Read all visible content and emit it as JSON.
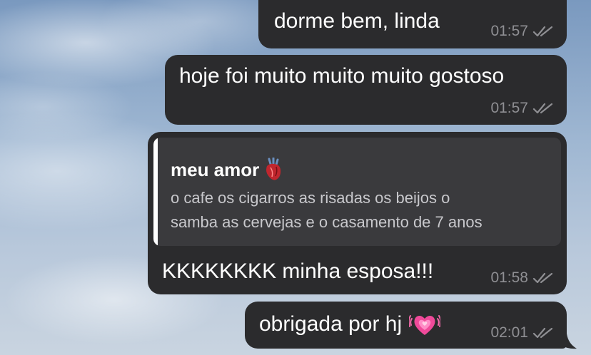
{
  "messages": [
    {
      "text": "dorme bem, linda",
      "time": "01:57"
    },
    {
      "text": "hoje foi muito muito muito gostoso",
      "time": "01:57"
    },
    {
      "reply": {
        "author": "meu amor",
        "author_emoji": "anatomical-heart-icon",
        "text_line1": "o cafe os cigarros as risadas os beijos o",
        "text_line2": "samba as cervejas e o casamento de 7 anos"
      },
      "text": "KKKKKKKK minha esposa!!!",
      "time": "01:58"
    },
    {
      "text": "obrigada por hj",
      "emoji": "growing-heart-icon",
      "time": "02:01"
    }
  ],
  "colors": {
    "bubble": "#2b2b2d",
    "reply_background": "#3a3a3d",
    "timestamp": "#8f8f93",
    "text": "#ffffff"
  }
}
